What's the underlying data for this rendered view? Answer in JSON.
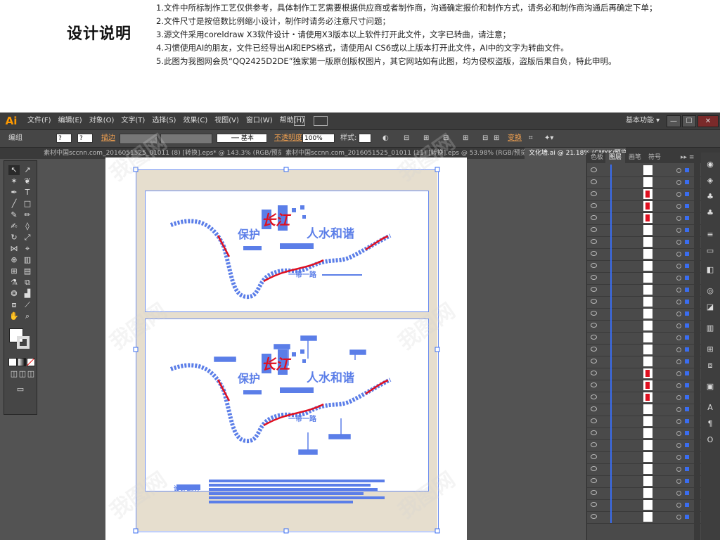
{
  "header": {
    "title": "设计说明",
    "notes": [
      "1.文件中所标制作工艺仅供参考，具体制作工艺需要根据供应商或者制作商，沟通确定报价和制作方式，请务必和制作商沟通后再确定下单；",
      "2.文件尺寸是按倍数比例缩小设计，制作时请务必注意尺寸问题；",
      "3.源文件采用coreldraw X3软件设计・请使用X3版本以上软件打开此文件，文字已转曲，请注意；",
      "4.习惯使用AI的朋友，文件已经导出AI和EPS格式，请使用AI CS6或以上版本打开此文件，AI中的文字为转曲文件。",
      "5.此图为我图网会员“QQ2425D2DE”独家第一版原创版权图片，其它网站如有此图，均为侵权盗版，盗版后果自负，特此申明。"
    ]
  },
  "app": {
    "logo": "Ai",
    "menus": [
      "文件(F)",
      "编辑(E)",
      "对象(O)",
      "文字(T)",
      "选择(S)",
      "效果(C)",
      "视图(V)",
      "窗口(W)",
      "帮助(H)"
    ],
    "workspace": "基本功能",
    "win_min": "—",
    "win_max": "☐",
    "win_close": "✕"
  },
  "control": {
    "mode": "编组",
    "stroke": "描边",
    "stroke_style": "基本",
    "opacity_label": "不透明度",
    "opacity_value": "100%",
    "style_label": "样式:",
    "transform": "变换"
  },
  "tabs": [
    {
      "label": "素材中国sccnn.com_2016051525_01011 (8) [转换].eps* @ 143.3% (RGB/预览)"
    },
    {
      "label": "素材中国sccnn.com_2016051525_01011 (11) [转换].eps @ 53.98% (RGB/预览)"
    },
    {
      "label": "文化墙.ai @ 21.18% (CMYK/预览)"
    }
  ],
  "panel": {
    "tabs": [
      "色板",
      "图层",
      "画笔",
      "符号"
    ],
    "row_count": 30
  },
  "artwork": {
    "heading_1": "保护",
    "heading_2": "长江",
    "heading_3": "人水和谐",
    "sub_caption": "一带一路",
    "bottom_label": "设计说明"
  },
  "watermark": "我图网",
  "colors": {
    "app_bg": "#535353",
    "menubar": "#3c3c3c",
    "accent_orange": "#ff9a00",
    "selection_blue": "#3a6df0",
    "path_blue": "#5b7ee8",
    "path_red": "#e01020",
    "panel_bg": "#e6dece"
  }
}
